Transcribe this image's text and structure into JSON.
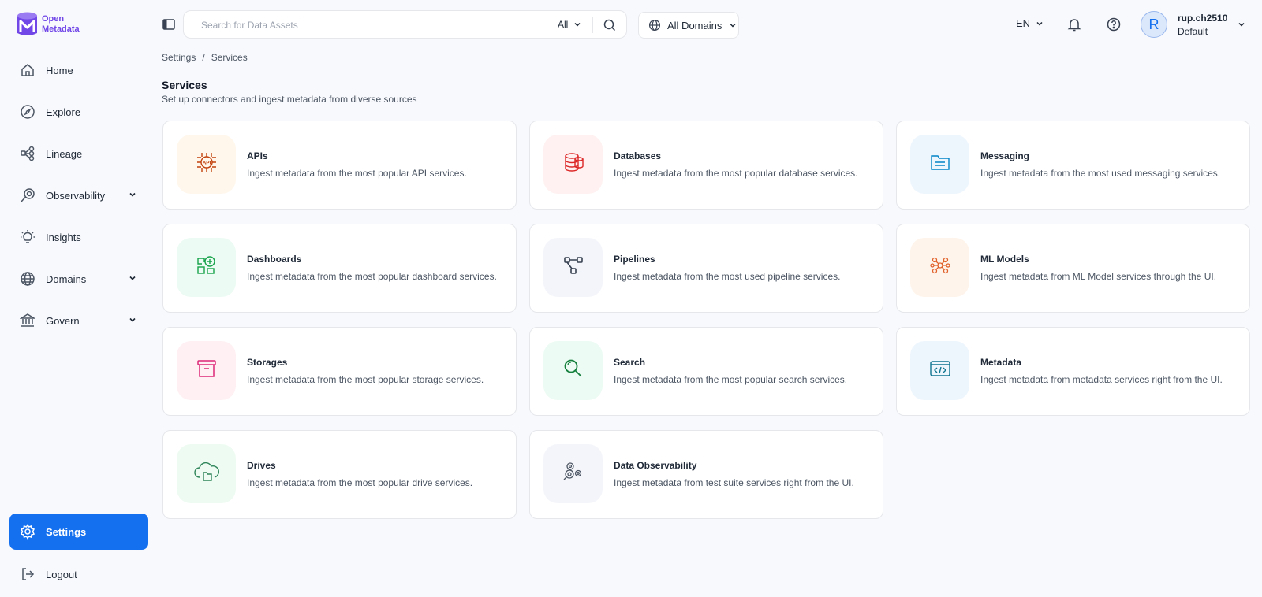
{
  "logo": {
    "line1": "Open",
    "line2": "Metadata"
  },
  "sidebar": {
    "items": [
      {
        "label": "Home",
        "icon": "home-icon"
      },
      {
        "label": "Explore",
        "icon": "compass-icon"
      },
      {
        "label": "Lineage",
        "icon": "lineage-icon"
      },
      {
        "label": "Observability",
        "icon": "observability-icon"
      },
      {
        "label": "Insights",
        "icon": "lightbulb-icon"
      },
      {
        "label": "Domains",
        "icon": "globe-icon"
      },
      {
        "label": "Govern",
        "icon": "bank-icon"
      }
    ],
    "settings_label": "Settings",
    "logout_label": "Logout"
  },
  "header": {
    "search_placeholder": "Search for Data Assets",
    "search_scope": "All",
    "domains_label": "All Domains",
    "language": "EN",
    "user_initial": "R",
    "user_name": "rup.ch2510",
    "user_role": "Default"
  },
  "breadcrumb": {
    "root": "Settings",
    "separator": "/",
    "current": "Services"
  },
  "page": {
    "title": "Services",
    "subtitle": "Set up connectors and ingest metadata from diverse sources"
  },
  "services": [
    {
      "title": "APIs",
      "desc": "Ingest metadata from the most popular API services.",
      "icon": "api-chip-icon",
      "bg": "#fff7ec",
      "fg": "#c2410c"
    },
    {
      "title": "Databases",
      "desc": "Ingest metadata from the most popular database services.",
      "icon": "database-icon",
      "bg": "#fff1f1",
      "fg": "#dc2626"
    },
    {
      "title": "Messaging",
      "desc": "Ingest metadata from the most used messaging services.",
      "icon": "folder-icon",
      "bg": "#eef6fd",
      "fg": "#0284c7"
    },
    {
      "title": "Dashboards",
      "desc": "Ingest metadata from the most popular dashboard services.",
      "icon": "dashboard-icon",
      "bg": "#ecfbf3",
      "fg": "#16a34a"
    },
    {
      "title": "Pipelines",
      "desc": "Ingest metadata from the most used pipeline services.",
      "icon": "pipeline-icon",
      "bg": "#f4f5fa",
      "fg": "#374151"
    },
    {
      "title": "ML Models",
      "desc": "Ingest metadata from ML Model services through the UI.",
      "icon": "ml-model-icon",
      "bg": "#fff4eb",
      "fg": "#e1612b"
    },
    {
      "title": "Storages",
      "desc": "Ingest metadata from the most popular storage services.",
      "icon": "archive-icon",
      "bg": "#fff0f3",
      "fg": "#db2777"
    },
    {
      "title": "Search",
      "desc": "Ingest metadata from the most popular search services.",
      "icon": "search-icon",
      "bg": "#ecfbf3",
      "fg": "#15803d"
    },
    {
      "title": "Metadata",
      "desc": "Ingest metadata from metadata services right from the UI.",
      "icon": "code-window-icon",
      "bg": "#eef6fd",
      "fg": "#0e7490"
    },
    {
      "title": "Drives",
      "desc": "Ingest metadata from the most popular drive services.",
      "icon": "cloud-folder-icon",
      "bg": "#eefbf2",
      "fg": "#2f855a"
    },
    {
      "title": "Data Observability",
      "desc": "Ingest metadata from test suite services right from the UI.",
      "icon": "data-observability-icon",
      "bg": "#f4f5fa",
      "fg": "#4b5563"
    }
  ],
  "colors": {
    "accent": "#1570ef",
    "brand": "#7147e8"
  }
}
